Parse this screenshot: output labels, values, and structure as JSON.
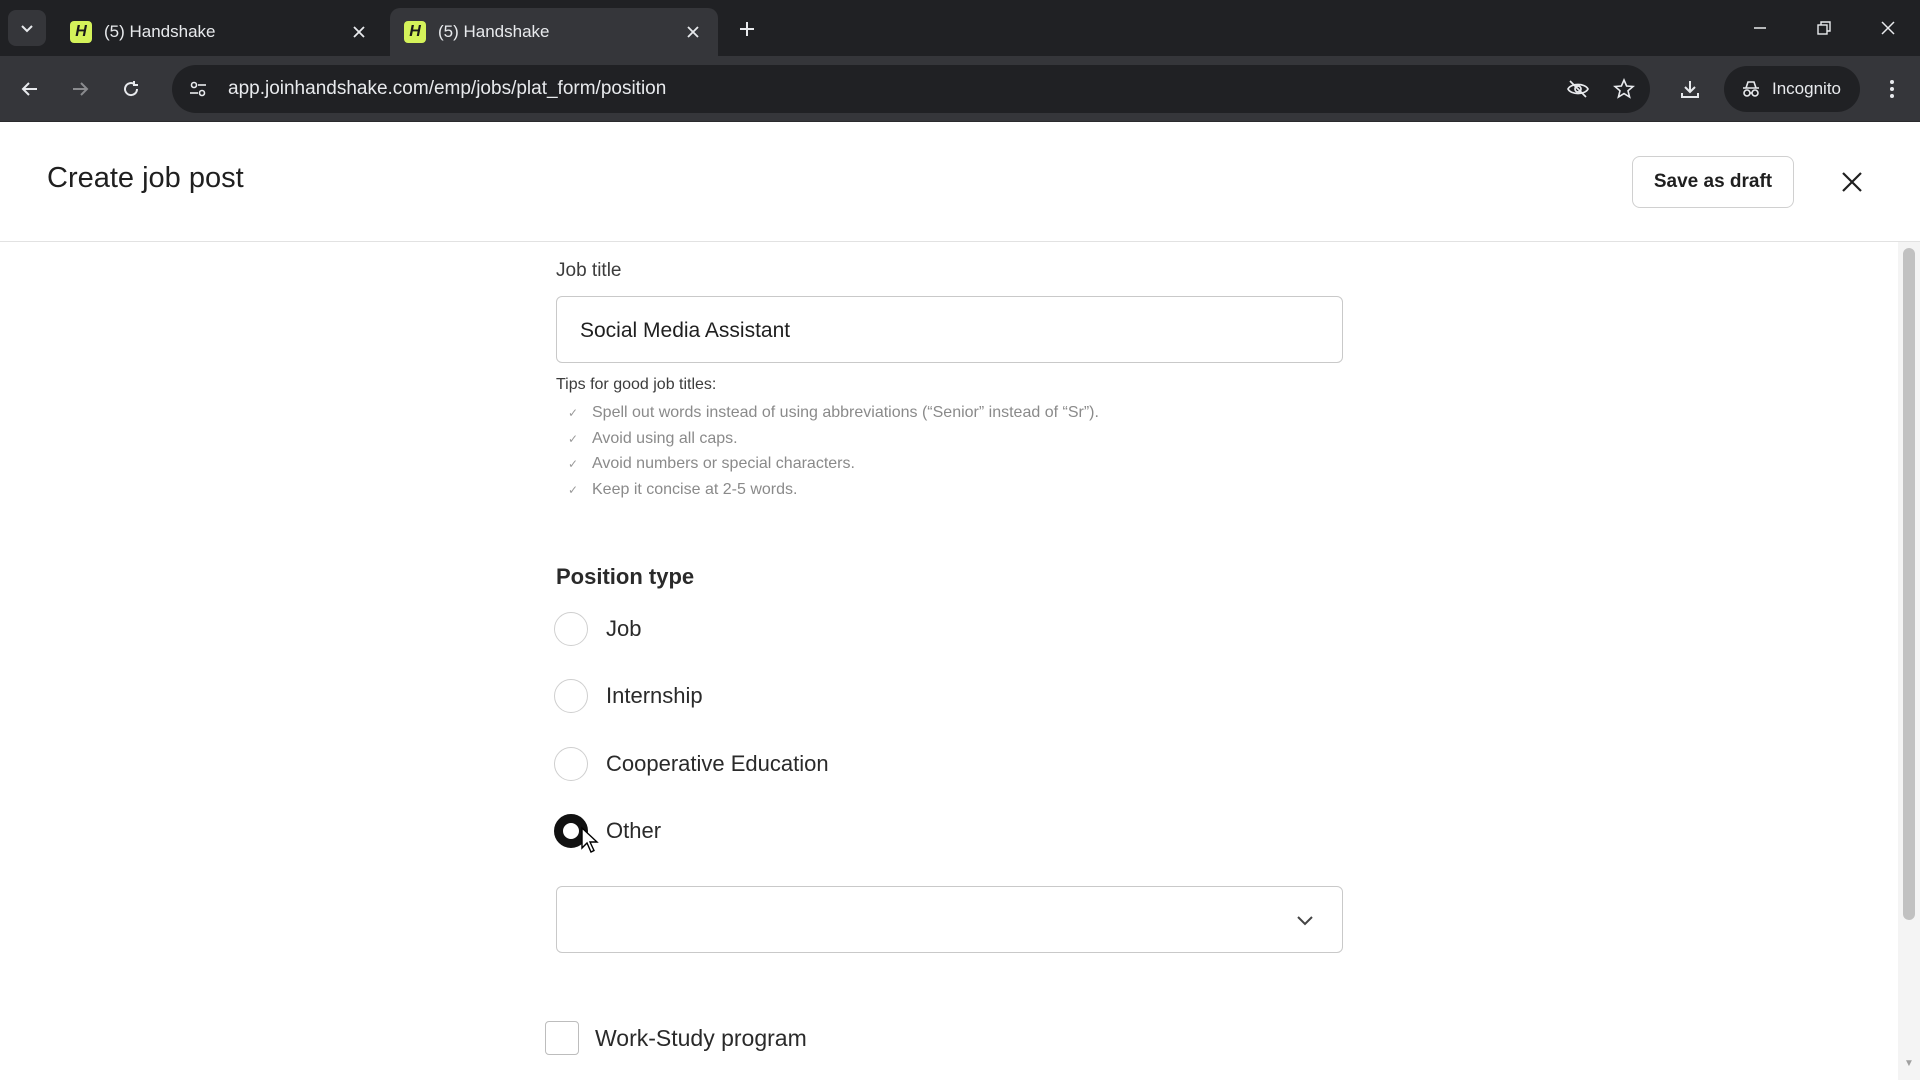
{
  "browser": {
    "tabs": [
      {
        "title": "(5) Handshake",
        "favicon": "H",
        "active": false
      },
      {
        "title": "(5) Handshake",
        "favicon": "H",
        "active": true
      }
    ],
    "url": "app.joinhandshake.com/emp/jobs/plat_form/position",
    "profile_label": "Incognito"
  },
  "header": {
    "title": "Create job post",
    "save_draft_label": "Save as draft"
  },
  "job_title": {
    "label": "Job title",
    "value": "Social Media Assistant"
  },
  "tips": {
    "title": "Tips for good job titles:",
    "items": [
      "Spell out words instead of using abbreviations (“Senior” instead of “Sr”).",
      "Avoid using all caps.",
      "Avoid numbers or special characters.",
      "Keep it concise at 2-5 words."
    ]
  },
  "position_type": {
    "title": "Position type",
    "options": [
      "Job",
      "Internship",
      "Cooperative Education",
      "Other"
    ],
    "selected": "Other"
  },
  "other_select": {
    "value": ""
  },
  "work_study": {
    "label": "Work-Study program",
    "checked": false
  },
  "colors": {
    "chrome_dark": "#202124",
    "chrome_mid": "#35363a",
    "favicon": "#d4f25a",
    "selected_radio": "#111111"
  }
}
